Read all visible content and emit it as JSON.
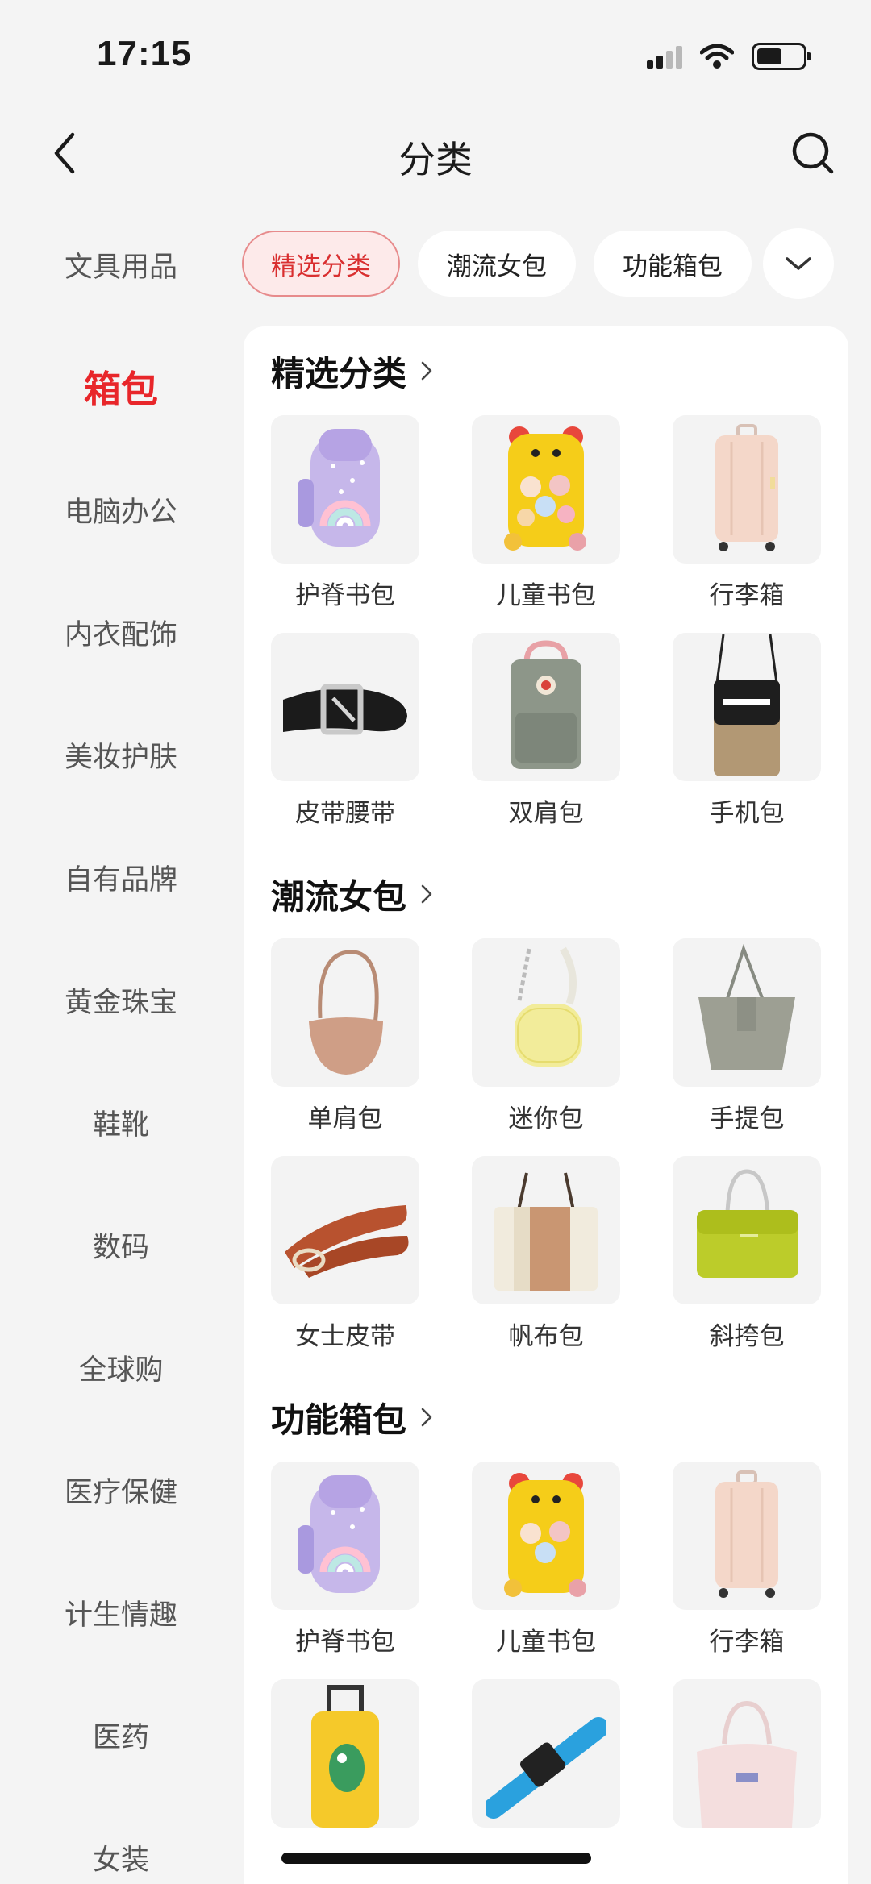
{
  "status_bar": {
    "time": "17:15"
  },
  "nav": {
    "title": "分类"
  },
  "sidebar": {
    "items": [
      {
        "label": "文具用品",
        "active": false
      },
      {
        "label": "箱包",
        "active": true
      },
      {
        "label": "电脑办公",
        "active": false
      },
      {
        "label": "内衣配饰",
        "active": false
      },
      {
        "label": "美妆护肤",
        "active": false
      },
      {
        "label": "自有品牌",
        "active": false
      },
      {
        "label": "黄金珠宝",
        "active": false
      },
      {
        "label": "鞋靴",
        "active": false
      },
      {
        "label": "数码",
        "active": false
      },
      {
        "label": "全球购",
        "active": false
      },
      {
        "label": "医疗保健",
        "active": false
      },
      {
        "label": "计生情趣",
        "active": false
      },
      {
        "label": "医药",
        "active": false
      },
      {
        "label": "女装",
        "active": false
      }
    ]
  },
  "chips": [
    {
      "label": "精选分类",
      "active": true
    },
    {
      "label": "潮流女包",
      "active": false
    },
    {
      "label": "功能箱包",
      "active": false
    }
  ],
  "sections": [
    {
      "title": "精选分类",
      "items": [
        {
          "label": "护脊书包",
          "icon": "backpack-purple"
        },
        {
          "label": "儿童书包",
          "icon": "backpack-yellow"
        },
        {
          "label": "行李箱",
          "icon": "suitcase-pink"
        },
        {
          "label": "皮带腰带",
          "icon": "belt-black"
        },
        {
          "label": "双肩包",
          "icon": "backpack-gray"
        },
        {
          "label": "手机包",
          "icon": "phone-bag"
        }
      ]
    },
    {
      "title": "潮流女包",
      "items": [
        {
          "label": "单肩包",
          "icon": "hobo-bag"
        },
        {
          "label": "迷你包",
          "icon": "mini-bag"
        },
        {
          "label": "手提包",
          "icon": "tote-gray"
        },
        {
          "label": "女士皮带",
          "icon": "belt-brown"
        },
        {
          "label": "帆布包",
          "icon": "canvas-bag"
        },
        {
          "label": "斜挎包",
          "icon": "crossbody-green"
        }
      ]
    },
    {
      "title": "功能箱包",
      "items": [
        {
          "label": "护脊书包",
          "icon": "backpack-purple"
        },
        {
          "label": "儿童书包",
          "icon": "backpack-yellow"
        },
        {
          "label": "行李箱",
          "icon": "suitcase-pink"
        },
        {
          "label": "",
          "icon": "kids-suitcase"
        },
        {
          "label": "",
          "icon": "luggage-strap"
        },
        {
          "label": "",
          "icon": "duffel-bag"
        }
      ]
    }
  ],
  "colors": {
    "accent": "#e8262a",
    "chip_active_bg": "#fdeaea",
    "page_bg": "#f4f4f4"
  }
}
